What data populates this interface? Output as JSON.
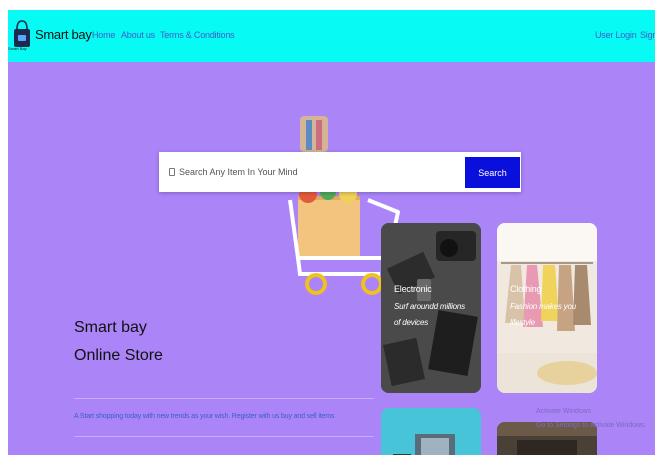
{
  "nav": {
    "brand": "Smart bay",
    "logo_caption": "Smart Bay",
    "links": [
      "Home",
      "About us",
      "Terms & Conditions"
    ],
    "user_login": "User Login",
    "signup_partial": "Sign"
  },
  "search": {
    "placeholder": "Search Any Item In Your Mind",
    "button_label": "Search"
  },
  "hero": {
    "title_line1": "Smart bay",
    "title_line2": "Online Store",
    "tagline": "A Start shopping today with new trends as your wish. Register with us buy and sell items"
  },
  "cards": [
    {
      "title": "Electronic",
      "subtitle_line1": "Surf aroundd millions",
      "subtitle_line2": "of devices"
    },
    {
      "title": "Clothing",
      "subtitle_line1": "Fashion makes you",
      "subtitle_line2": "lifestyle"
    }
  ],
  "watermark": {
    "line1": "Activate Windows",
    "line2": "Go to Settings to activate Windows."
  },
  "colors": {
    "navbar": "#05fbf4",
    "background": "#ab84f8",
    "search_button": "#0a10dc",
    "link": "#3a5fc8"
  }
}
